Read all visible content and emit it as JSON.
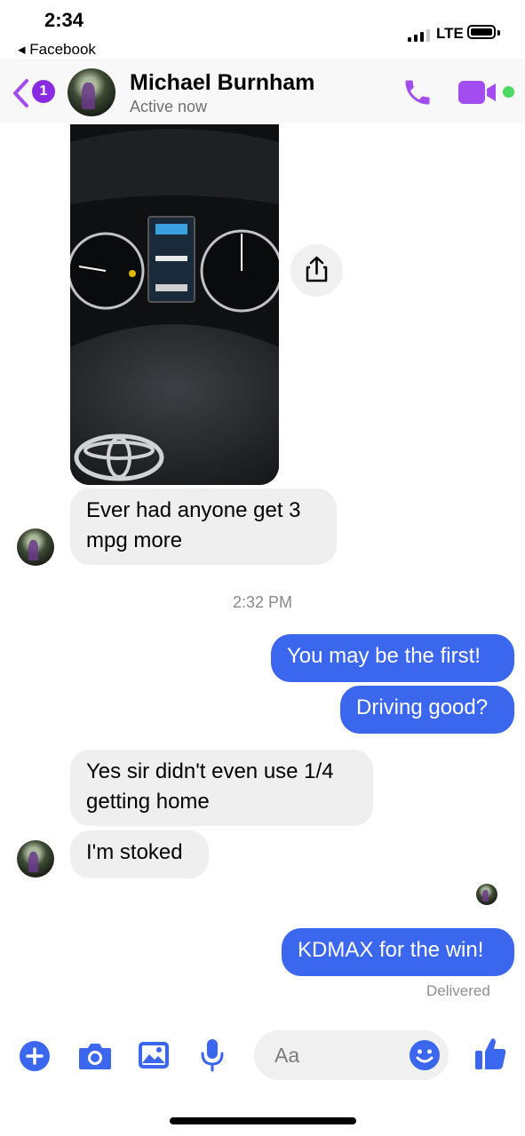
{
  "status_bar": {
    "time": "2:34",
    "back_app": "◂ Facebook",
    "network": "LTE"
  },
  "header": {
    "unread_count": "1",
    "contact_name": "Michael Burnham",
    "contact_status": "Active now"
  },
  "messages": [
    {
      "from": "them",
      "text": "Ever had anyone get 3 mpg more"
    },
    {
      "timestamp": "2:32 PM"
    },
    {
      "from": "me",
      "text": "You may be the first!"
    },
    {
      "from": "me",
      "text": "Driving good?"
    },
    {
      "from": "them",
      "text": "Yes sir didn't even use 1/4 getting home"
    },
    {
      "from": "them",
      "text": "I'm stoked"
    },
    {
      "from": "me",
      "text": "KDMAX for the win!"
    }
  ],
  "message_status": "Delivered",
  "composer": {
    "placeholder": "Aa"
  },
  "colors": {
    "accent": "#3b66ee",
    "header_icons": "#a34cf0",
    "active_dot": "#4cd964"
  }
}
